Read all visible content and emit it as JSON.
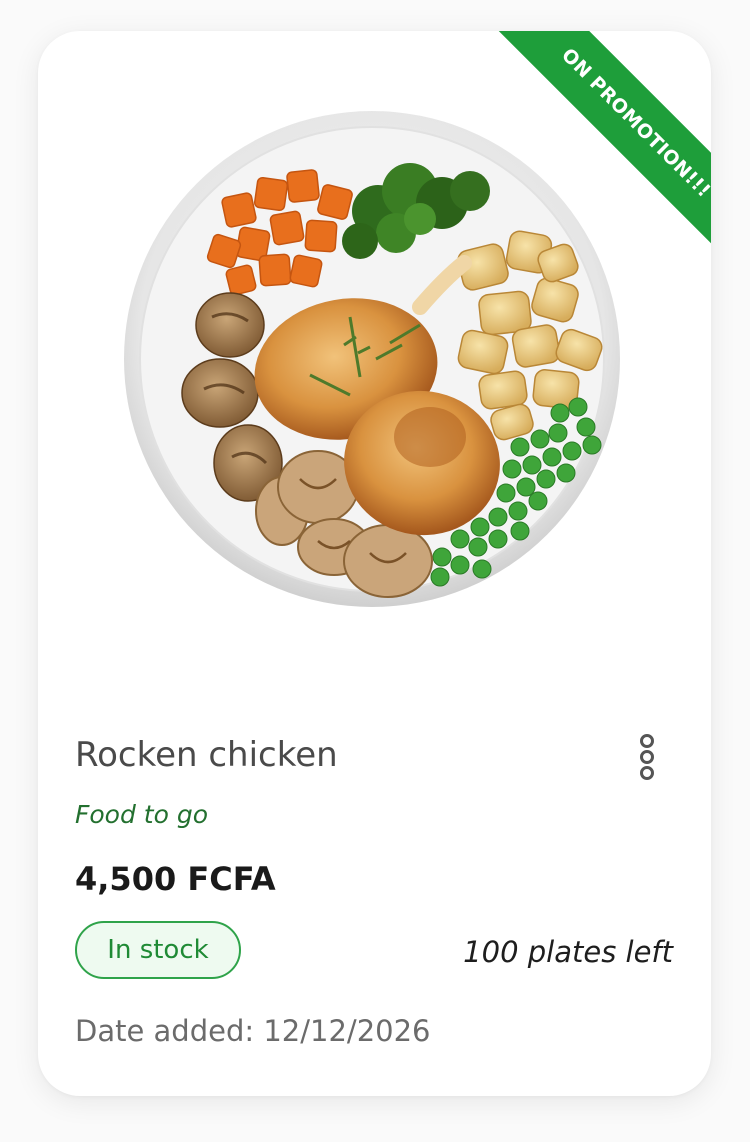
{
  "product": {
    "promo_label": "ON PROMOTION!!!",
    "image_icon": "roast-chicken-plate",
    "title": "Rocken chicken",
    "category": "Food to go",
    "price": "4,500 FCFA",
    "stock_status": "In stock",
    "remaining": "100 plates left",
    "date_added": "Date added: 12/12/2026"
  },
  "colors": {
    "accent_green": "#1e9e3a",
    "category_green": "#23702f",
    "badge_border": "#2fa34a",
    "badge_bg": "#eefaf0"
  },
  "icons": {
    "menu": "more-vertical-icon"
  }
}
